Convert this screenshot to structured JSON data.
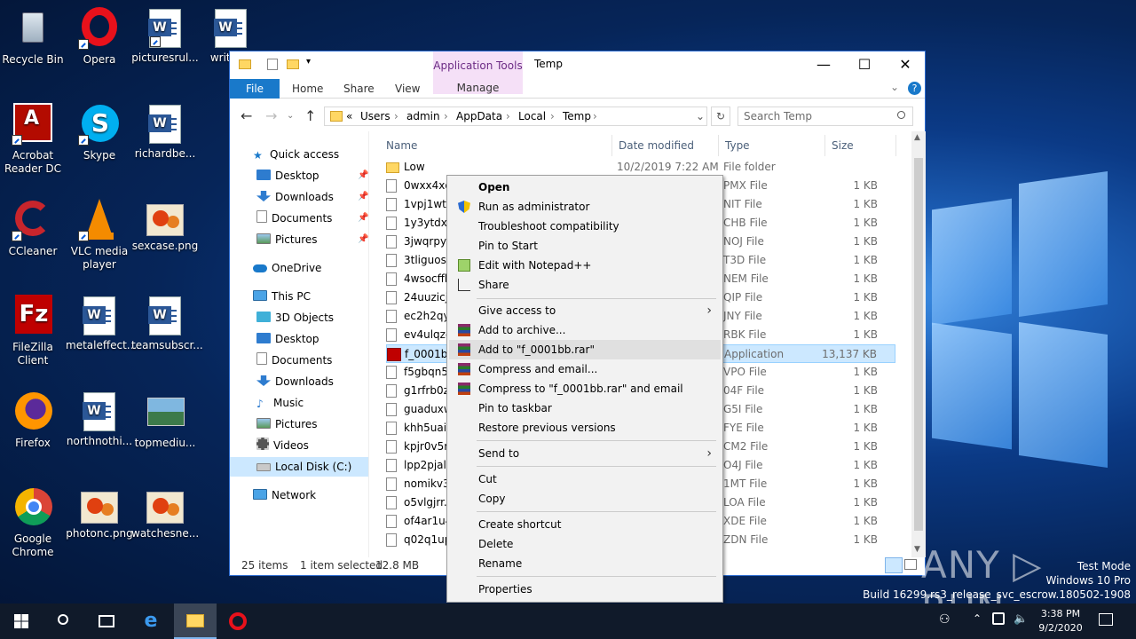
{
  "desktop": {
    "icons": [
      {
        "label": "Recycle Bin"
      },
      {
        "label": "Opera"
      },
      {
        "label": "picturesrul..."
      },
      {
        "label": "writte..."
      },
      {
        "label": "Acrobat Reader DC"
      },
      {
        "label": "Skype"
      },
      {
        "label": "richardbe..."
      },
      {
        "label": "CCleaner"
      },
      {
        "label": "VLC media player"
      },
      {
        "label": "sexcase.png"
      },
      {
        "label": "FileZilla Client"
      },
      {
        "label": "metaleffect..."
      },
      {
        "label": "teamsubscr..."
      },
      {
        "label": "Firefox"
      },
      {
        "label": "northnothi..."
      },
      {
        "label": "topmediu..."
      },
      {
        "label": "Google Chrome"
      },
      {
        "label": "photonc.png"
      },
      {
        "label": "watchesne..."
      }
    ]
  },
  "explorer": {
    "title": "Temp",
    "context_tab": "Application Tools",
    "context_tab_sub": "Manage",
    "ribbon_tabs": [
      "File",
      "Home",
      "Share",
      "View"
    ],
    "breadcrumb": [
      "«",
      "Users",
      "admin",
      "AppData",
      "Local",
      "Temp"
    ],
    "search_placeholder": "Search Temp",
    "nav": {
      "quick_access": "Quick access",
      "quick_items": [
        "Desktop",
        "Downloads",
        "Documents",
        "Pictures"
      ],
      "onedrive": "OneDrive",
      "this_pc": "This PC",
      "pc_items": [
        "3D Objects",
        "Desktop",
        "Documents",
        "Downloads",
        "Music",
        "Pictures",
        "Videos",
        "Local Disk (C:)"
      ],
      "network": "Network"
    },
    "columns": {
      "name": "Name",
      "date": "Date modified",
      "type": "Type",
      "size": "Size"
    },
    "files": [
      {
        "name": "Low",
        "date": "10/2/2019 7:22 AM",
        "type": "File folder",
        "size": ""
      },
      {
        "name": "0wxx4xqr",
        "date": "",
        "type": "PMX File",
        "size": "1 KB"
      },
      {
        "name": "1vpj1wtn",
        "date": "",
        "type": "NIT File",
        "size": "1 KB"
      },
      {
        "name": "1y3ytdxm",
        "date": "",
        "type": "CHB File",
        "size": "1 KB"
      },
      {
        "name": "3jwqrpyv",
        "date": "",
        "type": "NOJ File",
        "size": "1 KB"
      },
      {
        "name": "3tliguos.t",
        "date": "",
        "type": "T3D File",
        "size": "1 KB"
      },
      {
        "name": "4wsocffk",
        "date": "",
        "type": "NEM File",
        "size": "1 KB"
      },
      {
        "name": "24uuzicj.",
        "date": "",
        "type": "QIP File",
        "size": "1 KB"
      },
      {
        "name": "ec2h2qyk",
        "date": "",
        "type": "JNY File",
        "size": "1 KB"
      },
      {
        "name": "ev4ulqzg",
        "date": "",
        "type": "RBK File",
        "size": "1 KB"
      },
      {
        "name": "f_0001bb",
        "date": "",
        "type": "Application",
        "size": "13,137 KB"
      },
      {
        "name": "f5gbqn5c",
        "date": "",
        "type": "VPO File",
        "size": "1 KB"
      },
      {
        "name": "g1rfrb0z.",
        "date": "",
        "type": "04F File",
        "size": "1 KB"
      },
      {
        "name": "guaduxw",
        "date": "",
        "type": "G5I File",
        "size": "1 KB"
      },
      {
        "name": "khh5uaid",
        "date": "",
        "type": "FYE File",
        "size": "1 KB"
      },
      {
        "name": "kpjr0v5r.",
        "date": "",
        "type": "CM2 File",
        "size": "1 KB"
      },
      {
        "name": "lpp2pjal.",
        "date": "",
        "type": "O4J File",
        "size": "1 KB"
      },
      {
        "name": "nomikv3",
        "date": "",
        "type": "1MT File",
        "size": "1 KB"
      },
      {
        "name": "o5vlgjrr.l",
        "date": "",
        "type": "LOA File",
        "size": "1 KB"
      },
      {
        "name": "of4ar1u4",
        "date": "",
        "type": "XDE File",
        "size": "1 KB"
      },
      {
        "name": "q02q1up",
        "date": "",
        "type": "ZDN File",
        "size": "1 KB"
      }
    ],
    "status": {
      "count": "25 items",
      "selected": "1 item selected",
      "size": "12.8 MB"
    }
  },
  "context_menu": [
    {
      "label": "Open",
      "bold": true
    },
    {
      "label": "Run as administrator",
      "icon": "shield-icon"
    },
    {
      "label": "Troubleshoot compatibility"
    },
    {
      "label": "Pin to Start"
    },
    {
      "label": "Edit with Notepad++",
      "icon": "notepadpp-icon"
    },
    {
      "label": "Share",
      "icon": "share-icon"
    },
    {
      "label": "Give access to",
      "submenu": true
    },
    {
      "label": "Add to archive...",
      "icon": "winrar-icon"
    },
    {
      "label": "Add to \"f_0001bb.rar\"",
      "icon": "winrar-icon"
    },
    {
      "label": "Compress and email...",
      "icon": "winrar-icon"
    },
    {
      "label": "Compress to \"f_0001bb.rar\" and email",
      "icon": "winrar-icon"
    },
    {
      "label": "Pin to taskbar"
    },
    {
      "label": "Restore previous versions"
    },
    {
      "label": "Send to",
      "submenu": true
    },
    {
      "label": "Cut"
    },
    {
      "label": "Copy"
    },
    {
      "label": "Create shortcut"
    },
    {
      "label": "Delete"
    },
    {
      "label": "Rename"
    },
    {
      "label": "Properties"
    }
  ],
  "taskbar": {
    "time": "3:38 PM",
    "date": "9/2/2020"
  },
  "watermark": {
    "brand": "ANY ▷ RUN",
    "line1": "Test Mode",
    "line2": "Windows 10 Pro",
    "line3": "Build 16299.rs3_release_svc_escrow.180502-1908"
  },
  "colors": {
    "accent": "#1979ca",
    "selection": "#cce8ff",
    "context_tab": "#f5e0f7"
  }
}
